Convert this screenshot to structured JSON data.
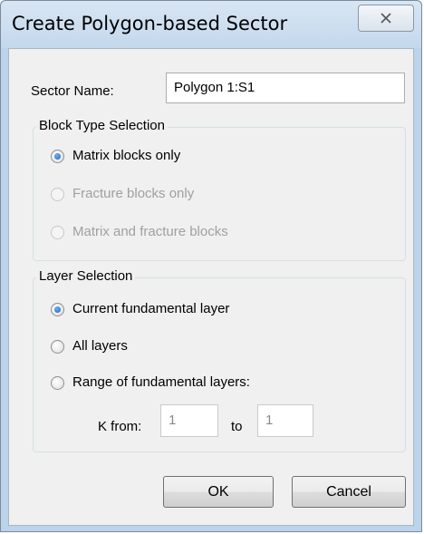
{
  "window": {
    "title": "Create Polygon-based Sector"
  },
  "sector": {
    "name_label": "Sector Name:",
    "name_value": "Polygon 1:S1"
  },
  "block_type": {
    "title": "Block Type Selection",
    "options": [
      {
        "label": "Matrix blocks only",
        "checked": true,
        "enabled": true
      },
      {
        "label": "Fracture blocks only",
        "checked": false,
        "enabled": false
      },
      {
        "label": "Matrix and fracture blocks",
        "checked": false,
        "enabled": false
      }
    ]
  },
  "layer": {
    "title": "Layer Selection",
    "options": [
      {
        "label": "Current fundamental layer",
        "checked": true,
        "enabled": true
      },
      {
        "label": "All layers",
        "checked": false,
        "enabled": true
      },
      {
        "label": "Range of fundamental layers:",
        "checked": false,
        "enabled": true
      }
    ],
    "k_from_label": "K from:",
    "k_from_value": "1",
    "to_label": "to",
    "k_to_value": "1"
  },
  "buttons": {
    "ok": "OK",
    "cancel": "Cancel"
  },
  "icons": {
    "close": "close-icon",
    "radio": "radio-icon"
  }
}
